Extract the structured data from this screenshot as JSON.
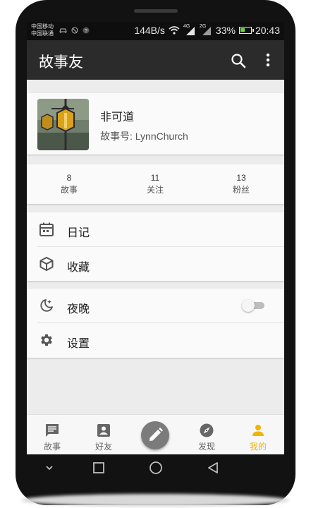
{
  "status_bar": {
    "carrier_1": "中国移动",
    "carrier_2": "中国联通",
    "speed": "144B/s",
    "network_1": "4G",
    "network_2": "2G",
    "battery": "33%",
    "time": "20:43"
  },
  "app_bar": {
    "title": "故事友",
    "search_icon": "search-icon",
    "more_icon": "more-vert-icon"
  },
  "profile": {
    "name": "非可道",
    "story_id_label": "故事号:",
    "story_id": "LynnChurch"
  },
  "stats": [
    {
      "count": "8",
      "label": "故事"
    },
    {
      "count": "11",
      "label": "关注"
    },
    {
      "count": "13",
      "label": "粉丝"
    }
  ],
  "menu": {
    "diary": "日记",
    "favorites": "收藏",
    "night": "夜晚",
    "night_enabled": false,
    "settings": "设置"
  },
  "bottom_nav": {
    "stories": "故事",
    "friends": "好友",
    "discover": "发现",
    "mine": "我的",
    "active_color": "#f3b300"
  }
}
